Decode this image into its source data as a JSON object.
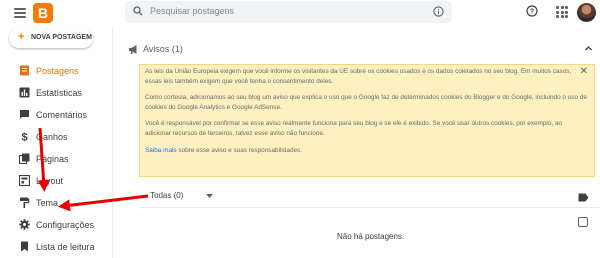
{
  "header": {
    "search_placeholder": "Pesquisar postagens"
  },
  "sidebar": {
    "new_post_label": "NOVA POSTAGEM",
    "items": [
      {
        "label": "Postagens",
        "icon": "posts-icon",
        "active": true
      },
      {
        "label": "Estatísticas",
        "icon": "stats-icon"
      },
      {
        "label": "Comentários",
        "icon": "comments-icon"
      },
      {
        "label": "Ganhos",
        "icon": "dollar-icon"
      },
      {
        "label": "Páginas",
        "icon": "pages-icon"
      },
      {
        "label": "Layout",
        "icon": "layout-icon"
      },
      {
        "label": "Tema",
        "icon": "paint-roller-icon"
      },
      {
        "label": "Configurações",
        "icon": "gear-icon"
      },
      {
        "label": "Lista de leitura",
        "icon": "bookmark-icon"
      }
    ]
  },
  "notices": {
    "title": "Avisos (1)",
    "paragraphs": [
      "As leis da União Europeia exigem que você informe os visitantes da UE sobre os cookies usados e os dados coletados no seu blog. Em muitos casos, essas leis também exigem que você tenha o consentimento deles.",
      "Como cortesia, adicionamos ao seu blog um aviso que explica o uso que o Google faz de determinados cookies do Blogger e do Google, incluindo o uso de cookies do Google Analytics e Google AdSense.",
      "Você é responsável por confirmar se esse aviso realmente funciona para seu blog e se ele é exibido. Se você usar outros cookies, por exemplo, ao adicionar recursos de terceiros, talvez esse aviso não funcione."
    ],
    "link_text": "Saiba mais",
    "link_suffix": " sobre esse aviso e suas responsabilidades."
  },
  "posts": {
    "filter_label": "Todas (0)",
    "empty_message": "Não há postagens."
  },
  "colors": {
    "accent": "#e8710a",
    "arrow": "#e60000",
    "notice_bg": "#fdf0c1"
  }
}
